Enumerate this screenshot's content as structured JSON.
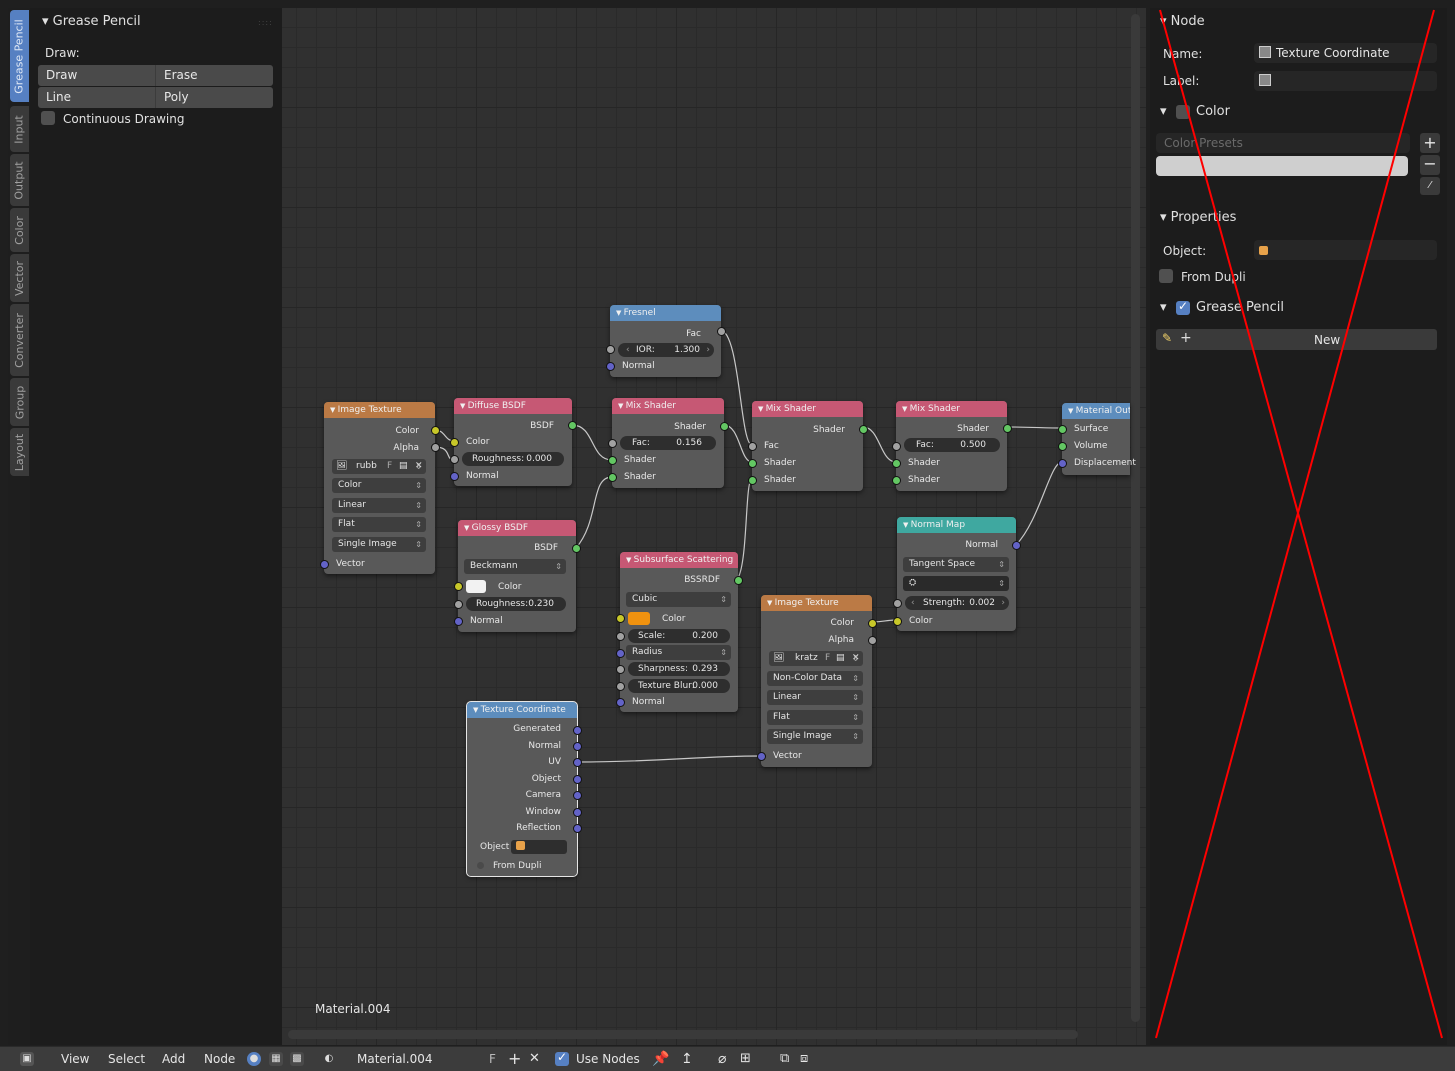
{
  "vertical_tabs": [
    "Grease Pencil",
    "Input",
    "Output",
    "Color",
    "Vector",
    "Converter",
    "Group",
    "Layout"
  ],
  "left_panel": {
    "title": "Grease Pencil",
    "draw_label": "Draw:",
    "buttons_row1": [
      "Draw",
      "Erase"
    ],
    "buttons_row2": [
      "Line",
      "Poly"
    ],
    "continuous_drawing": "Continuous Drawing"
  },
  "canvas": {
    "material_label": "Material.004"
  },
  "nodes": {
    "fresnel": {
      "title": "Fresnel",
      "out": "Fac",
      "ior_label": "IOR:",
      "ior": "1.300",
      "normal": "Normal"
    },
    "image_texture_1": {
      "title": "Image Texture",
      "color": "Color",
      "alpha": "Alpha",
      "image": "rubb",
      "f": "F",
      "color_space": "Color",
      "interp": "Linear",
      "projection": "Flat",
      "source": "Single Image",
      "vector": "Vector"
    },
    "diffuse": {
      "title": "Diffuse BSDF",
      "out": "BSDF",
      "color": "Color",
      "roughness_label": "Roughness:",
      "roughness": "0.000",
      "normal": "Normal"
    },
    "glossy": {
      "title": "Glossy BSDF",
      "out": "BSDF",
      "dist": "Beckmann",
      "color": "Color",
      "roughness_label": "Roughness:",
      "roughness": "0.230",
      "normal": "Normal"
    },
    "mix1": {
      "title": "Mix Shader",
      "out": "Shader",
      "fac_label": "Fac:",
      "fac": "0.156",
      "in1": "Shader",
      "in2": "Shader"
    },
    "mix2": {
      "title": "Mix Shader",
      "out": "Shader",
      "fac": "Fac",
      "in1": "Shader",
      "in2": "Shader"
    },
    "mix3": {
      "title": "Mix Shader",
      "out": "Shader",
      "fac_label": "Fac:",
      "fac": "0.500",
      "in1": "Shader",
      "in2": "Shader"
    },
    "output": {
      "title": "Material Out",
      "surface": "Surface",
      "volume": "Volume",
      "displacement": "Displacement"
    },
    "sss": {
      "title": "Subsurface Scattering",
      "out": "BSSRDF",
      "falloff": "Cubic",
      "color": "Color",
      "scale_label": "Scale:",
      "scale": "0.200",
      "radius": "Radius",
      "sharpness_label": "Sharpness:",
      "sharpness": "0.293",
      "blur_label": "Texture Blur:",
      "blur": "0.000",
      "normal": "Normal"
    },
    "image_texture_2": {
      "title": "Image Texture",
      "color": "Color",
      "alpha": "Alpha",
      "image": "kratz",
      "f": "F",
      "color_space": "Non-Color Data",
      "interp": "Linear",
      "projection": "Flat",
      "source": "Single Image",
      "vector": "Vector"
    },
    "normal_map": {
      "title": "Normal Map",
      "out": "Normal",
      "space": "Tangent Space",
      "strength_label": "Strength:",
      "strength": "0.002",
      "color": "Color"
    },
    "texcoord": {
      "title": "Texture Coordinate",
      "outs": [
        "Generated",
        "Normal",
        "UV",
        "Object",
        "Camera",
        "Window",
        "Reflection"
      ],
      "object_label": "Object",
      "from_dupli": "From Dupli"
    }
  },
  "right_panel": {
    "node_title": "Node",
    "name_label": "Name:",
    "name_value": "Texture Coordinate",
    "label_label": "Label:",
    "color_title": "Color",
    "color_presets": "Color Presets",
    "properties_title": "Properties",
    "object_label": "Object:",
    "from_dupli": "From Dupli",
    "grease_pencil_title": "Grease Pencil",
    "new_button": "New"
  },
  "header": {
    "menus": [
      "View",
      "Select",
      "Add",
      "Node"
    ],
    "material_name": "Material.004",
    "f": "F",
    "use_nodes": "Use Nodes"
  },
  "colors": {
    "accent": "#5680c2",
    "texture_header": "#bb7a45",
    "shader_header": "#c65874",
    "input_header": "#5d8dbd",
    "vector_header": "#3fa8a0",
    "socket_color": "#c7c729",
    "socket_shader": "#63c763",
    "socket_vector": "#6363c7",
    "overlay_cross": "#ff0000"
  }
}
